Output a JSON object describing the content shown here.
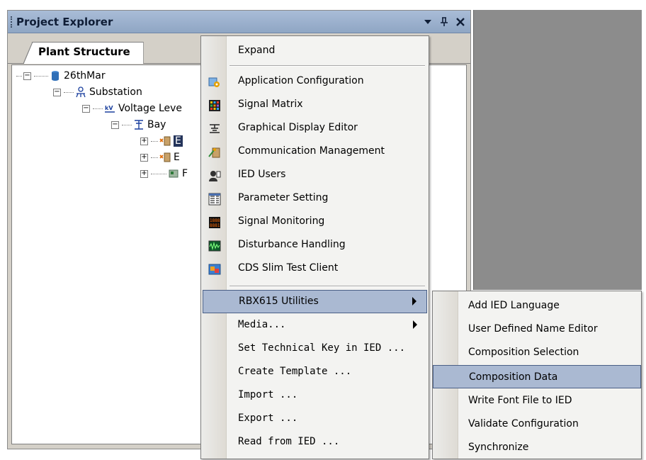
{
  "panel": {
    "title": "Project Explorer",
    "buttons": {
      "dropdown": "▼",
      "pin": "⊥",
      "close": "✕"
    },
    "tab": "Plant Structure"
  },
  "tree": {
    "root": "26thMar",
    "substation": "Substation",
    "voltage_level": "Voltage Leve",
    "bay": "Bay",
    "child1": "E",
    "child2": "E",
    "child3": "F"
  },
  "menu": {
    "items": [
      {
        "label": "Expand",
        "icon": ""
      },
      {
        "label": "Application Configuration",
        "icon": "app-config-icon"
      },
      {
        "label": "Signal Matrix",
        "icon": "signal-matrix-icon"
      },
      {
        "label": "Graphical Display Editor",
        "icon": "display-editor-icon"
      },
      {
        "label": "Communication Management",
        "icon": "communication-icon"
      },
      {
        "label": "IED Users",
        "icon": "ied-users-icon"
      },
      {
        "label": "Parameter Setting",
        "icon": "parameter-icon"
      },
      {
        "label": "Signal Monitoring",
        "icon": "signal-monitoring-icon"
      },
      {
        "label": "Disturbance Handling",
        "icon": "disturbance-icon"
      },
      {
        "label": "CDS Slim Test Client",
        "icon": "test-client-icon"
      },
      {
        "label": "RBX615 Utilities",
        "icon": ""
      },
      {
        "label": "Media...",
        "icon": ""
      },
      {
        "label": "Set Technical Key in IED ...",
        "icon": ""
      },
      {
        "label": "Create Template ...",
        "icon": ""
      },
      {
        "label": "Import ...",
        "icon": ""
      },
      {
        "label": "Export ...",
        "icon": ""
      },
      {
        "label": "Read from IED ...",
        "icon": ""
      }
    ]
  },
  "submenu": {
    "items": [
      {
        "label": "Add IED Language"
      },
      {
        "label": "User Defined Name Editor"
      },
      {
        "label": "Composition Selection"
      },
      {
        "label": "Composition Data"
      },
      {
        "label": "Write Font File to IED"
      },
      {
        "label": "Validate Configuration"
      },
      {
        "label": "Synchronize"
      }
    ]
  },
  "colors": {
    "title_bar": "#a9bcd7",
    "selection": "#aab9d2",
    "selection_border": "#4a5f86"
  }
}
